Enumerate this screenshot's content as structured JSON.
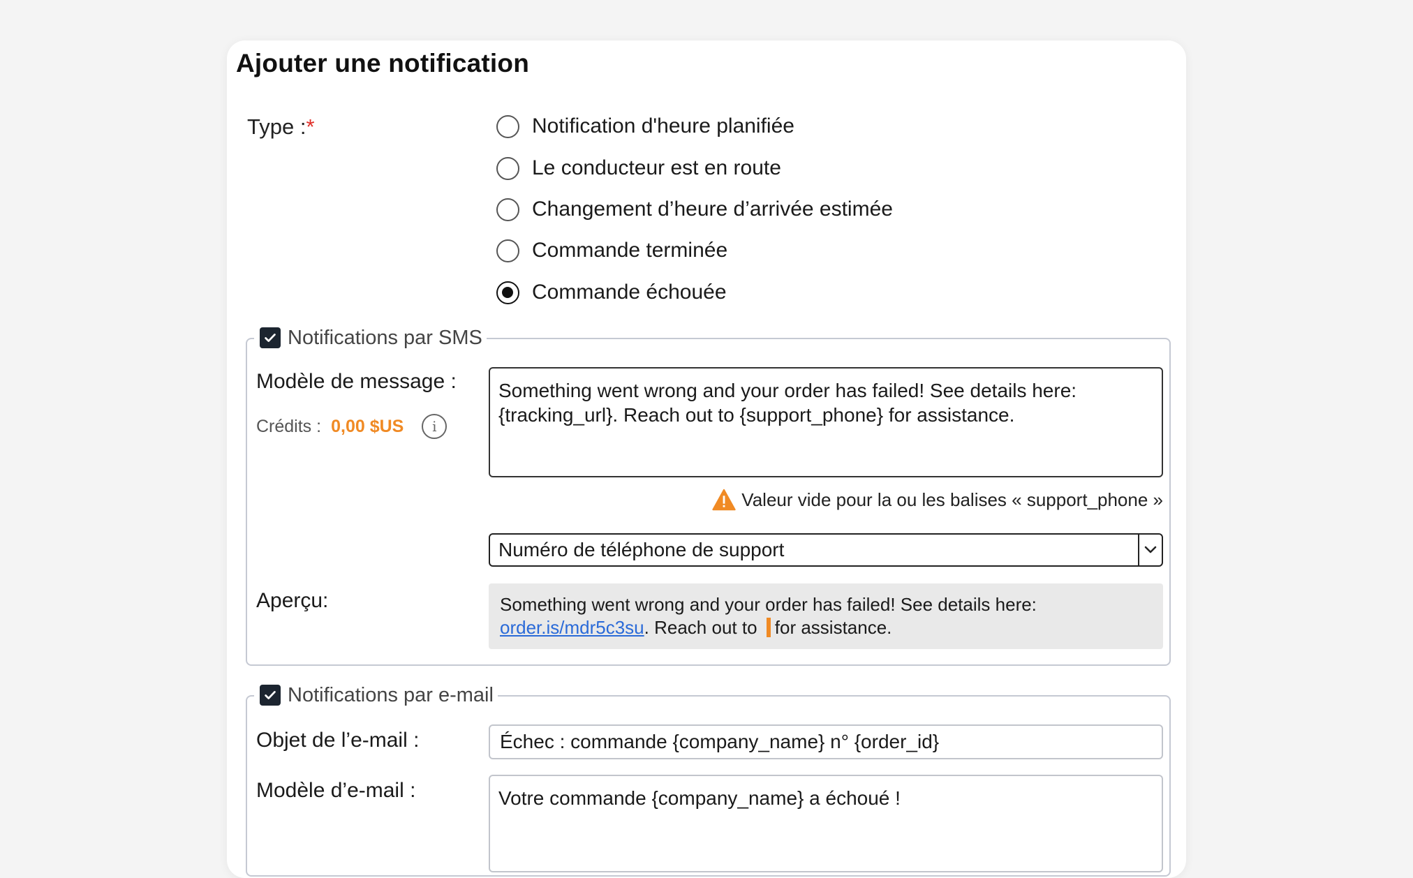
{
  "form": {
    "title": "Ajouter une notification",
    "type_label": "Type :",
    "required_mark": "*",
    "type_options": [
      {
        "label": "Notification d'heure planifiée",
        "checked": false
      },
      {
        "label": "Le conducteur est en route",
        "checked": false
      },
      {
        "label": "Changement d’heure d’arrivée estimée",
        "checked": false
      },
      {
        "label": "Commande terminée",
        "checked": false
      },
      {
        "label": "Commande échouée",
        "checked": true
      }
    ]
  },
  "sms": {
    "enabled": true,
    "legend": "Notifications par SMS",
    "template_label": "Modèle de message :",
    "credits_label": "Crédits :",
    "credits_value": "0,00 $US",
    "info_icon": "info-icon",
    "template_line1": "Something went wrong and your order has failed! See details here:",
    "template_line2": "{tracking_url}. Reach out to {support_phone} for assistance.",
    "warning_icon": "warning-triangle-icon",
    "warning_text": "Valeur vide pour la ou les balises « support_phone »",
    "tag_select_value": "Numéro de téléphone de support",
    "preview_label": "Aperçu:",
    "preview_text_before": "Something went wrong and your order has failed! See details here:",
    "preview_link": "order.is/mdr5c3su",
    "preview_text_mid": ". Reach out to",
    "preview_text_after": "for assistance."
  },
  "email": {
    "enabled": true,
    "legend": "Notifications par e-mail",
    "subject_label": "Objet de l’e-mail :",
    "subject_value": "Échec : commande {company_name} n° {order_id}",
    "template_label": "Modèle d’e-mail :",
    "template_value": "Votre commande {company_name} a échoué !"
  },
  "colors": {
    "accent_orange": "#f08a24",
    "link_blue": "#2a6ad8",
    "required_red": "#e0302a",
    "checkbox_dark": "#1c2530"
  }
}
